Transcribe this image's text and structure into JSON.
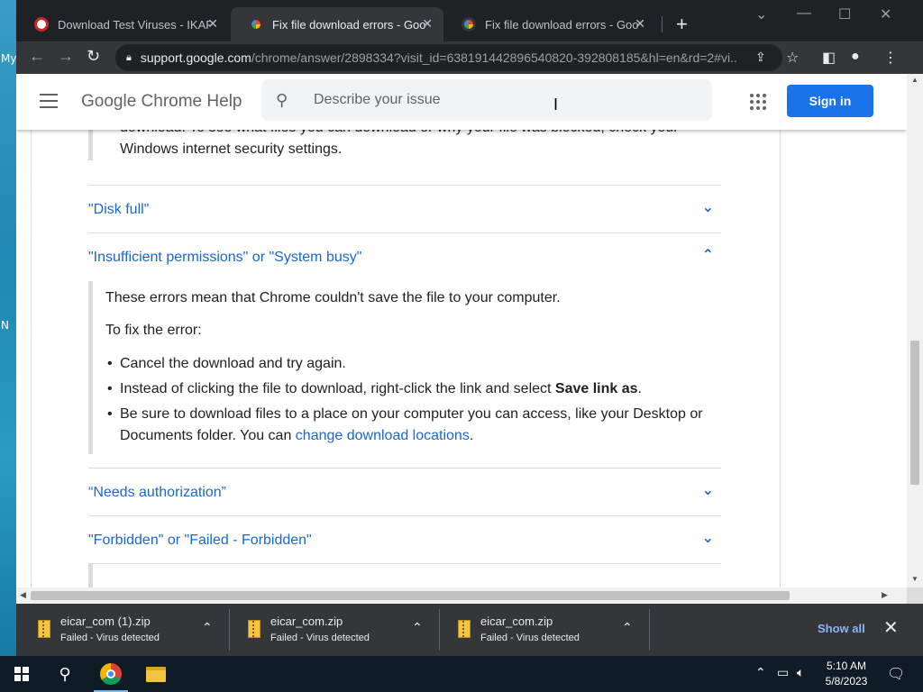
{
  "desktop": {
    "labels": [
      "My",
      "N"
    ]
  },
  "tabs": [
    {
      "title": "Download Test Viruses - IKARUS",
      "favicon": "ikarus-icon"
    },
    {
      "title": "Fix file download errors - Google",
      "favicon": "google-icon"
    },
    {
      "title": "Fix file download errors - Google",
      "favicon": "google-icon"
    }
  ],
  "omnibox": {
    "host": "support.google.com",
    "path": "/chrome/answer/2898334?visit_id=638191442896540820-392808185&hl=en&rd=2#vi..."
  },
  "help": {
    "brand": "Google Chrome Help",
    "search_placeholder": "Describe your issue",
    "sign_in": "Sign in"
  },
  "article": {
    "prev_text_partial": "download. To see what files you can download or why your file was blocked, check your",
    "prev_text_line2": "Windows internet security settings.",
    "sections": [
      {
        "title": "\"Disk full\"",
        "expanded": false
      },
      {
        "title": "\"Insufficient permissions\" or \"System busy\"",
        "expanded": true
      },
      {
        "title": "“Needs authorization”",
        "expanded": false
      },
      {
        "title": "\"Forbidden\" or \"Failed - Forbidden\"",
        "expanded": false
      }
    ],
    "expanded_body": {
      "intro": "These errors mean that Chrome couldn't save the file to your computer.",
      "fix_label": "To fix the error:",
      "bullet1": "Cancel the download and try again.",
      "bullet2_pre": "Instead of clicking the file to download, right-click the link and select ",
      "bullet2_bold": "Save link as",
      "bullet2_post": ".",
      "bullet3_pre": "Be sure to download files to a place on your computer you can access, like your Desktop or Documents folder. You can ",
      "bullet3_link": "change download locations",
      "bullet3_post": "."
    }
  },
  "downloads": [
    {
      "filename": "eicar_com (1).zip",
      "status": "Failed - Virus detected"
    },
    {
      "filename": "eicar_com.zip",
      "status": "Failed - Virus detected"
    },
    {
      "filename": "eicar_com.zip",
      "status": "Failed - Virus detected"
    }
  ],
  "shelf": {
    "show_all": "Show all"
  },
  "taskbar": {
    "time": "5:10 AM",
    "date": "5/8/2023"
  }
}
